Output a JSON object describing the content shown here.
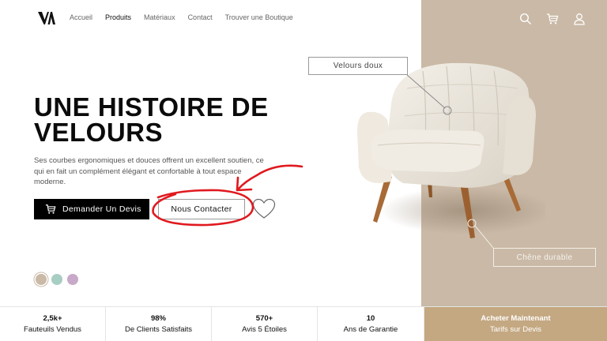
{
  "brand": {
    "logo_text": "VA"
  },
  "nav": {
    "items": [
      {
        "label": "Accueil",
        "active": false
      },
      {
        "label": "Produits",
        "active": true
      },
      {
        "label": "Matériaux",
        "active": false
      },
      {
        "label": "Contact",
        "active": false
      },
      {
        "label": "Trouver une Boutique",
        "active": false
      }
    ],
    "icons": [
      "search-icon",
      "cart-icon",
      "user-icon"
    ]
  },
  "hero": {
    "title_line1": "UNE HISTOIRE DE",
    "title_line2": "VELOURS",
    "description": "Ses courbes ergonomiques et douces offrent un excellent soutien, ce qui en fait un complément élégant et confortable à tout espace moderne.",
    "primary_button": "Demander Un Devis",
    "secondary_button": "Nous Contacter",
    "swatches": [
      "#c9b9a6",
      "#a8cdc3",
      "#c8a9c9"
    ]
  },
  "callouts": {
    "fabric": "Velours doux",
    "wood": "Chêne durable"
  },
  "stats": [
    {
      "value": "2,5k+",
      "label": "Fauteuils Vendus"
    },
    {
      "value": "98%",
      "label": "De Clients Satisfaits"
    },
    {
      "value": "570+",
      "label": "Avis 5 Étoiles"
    },
    {
      "value": "10",
      "label": "Ans de Garantie"
    }
  ],
  "cta": {
    "title": "Acheter Maintenant",
    "subtitle": "Tarifs sur Devis"
  },
  "colors": {
    "panel": "#c9b9a6",
    "cta": "#c4a882",
    "annotation": "#e0191f"
  }
}
